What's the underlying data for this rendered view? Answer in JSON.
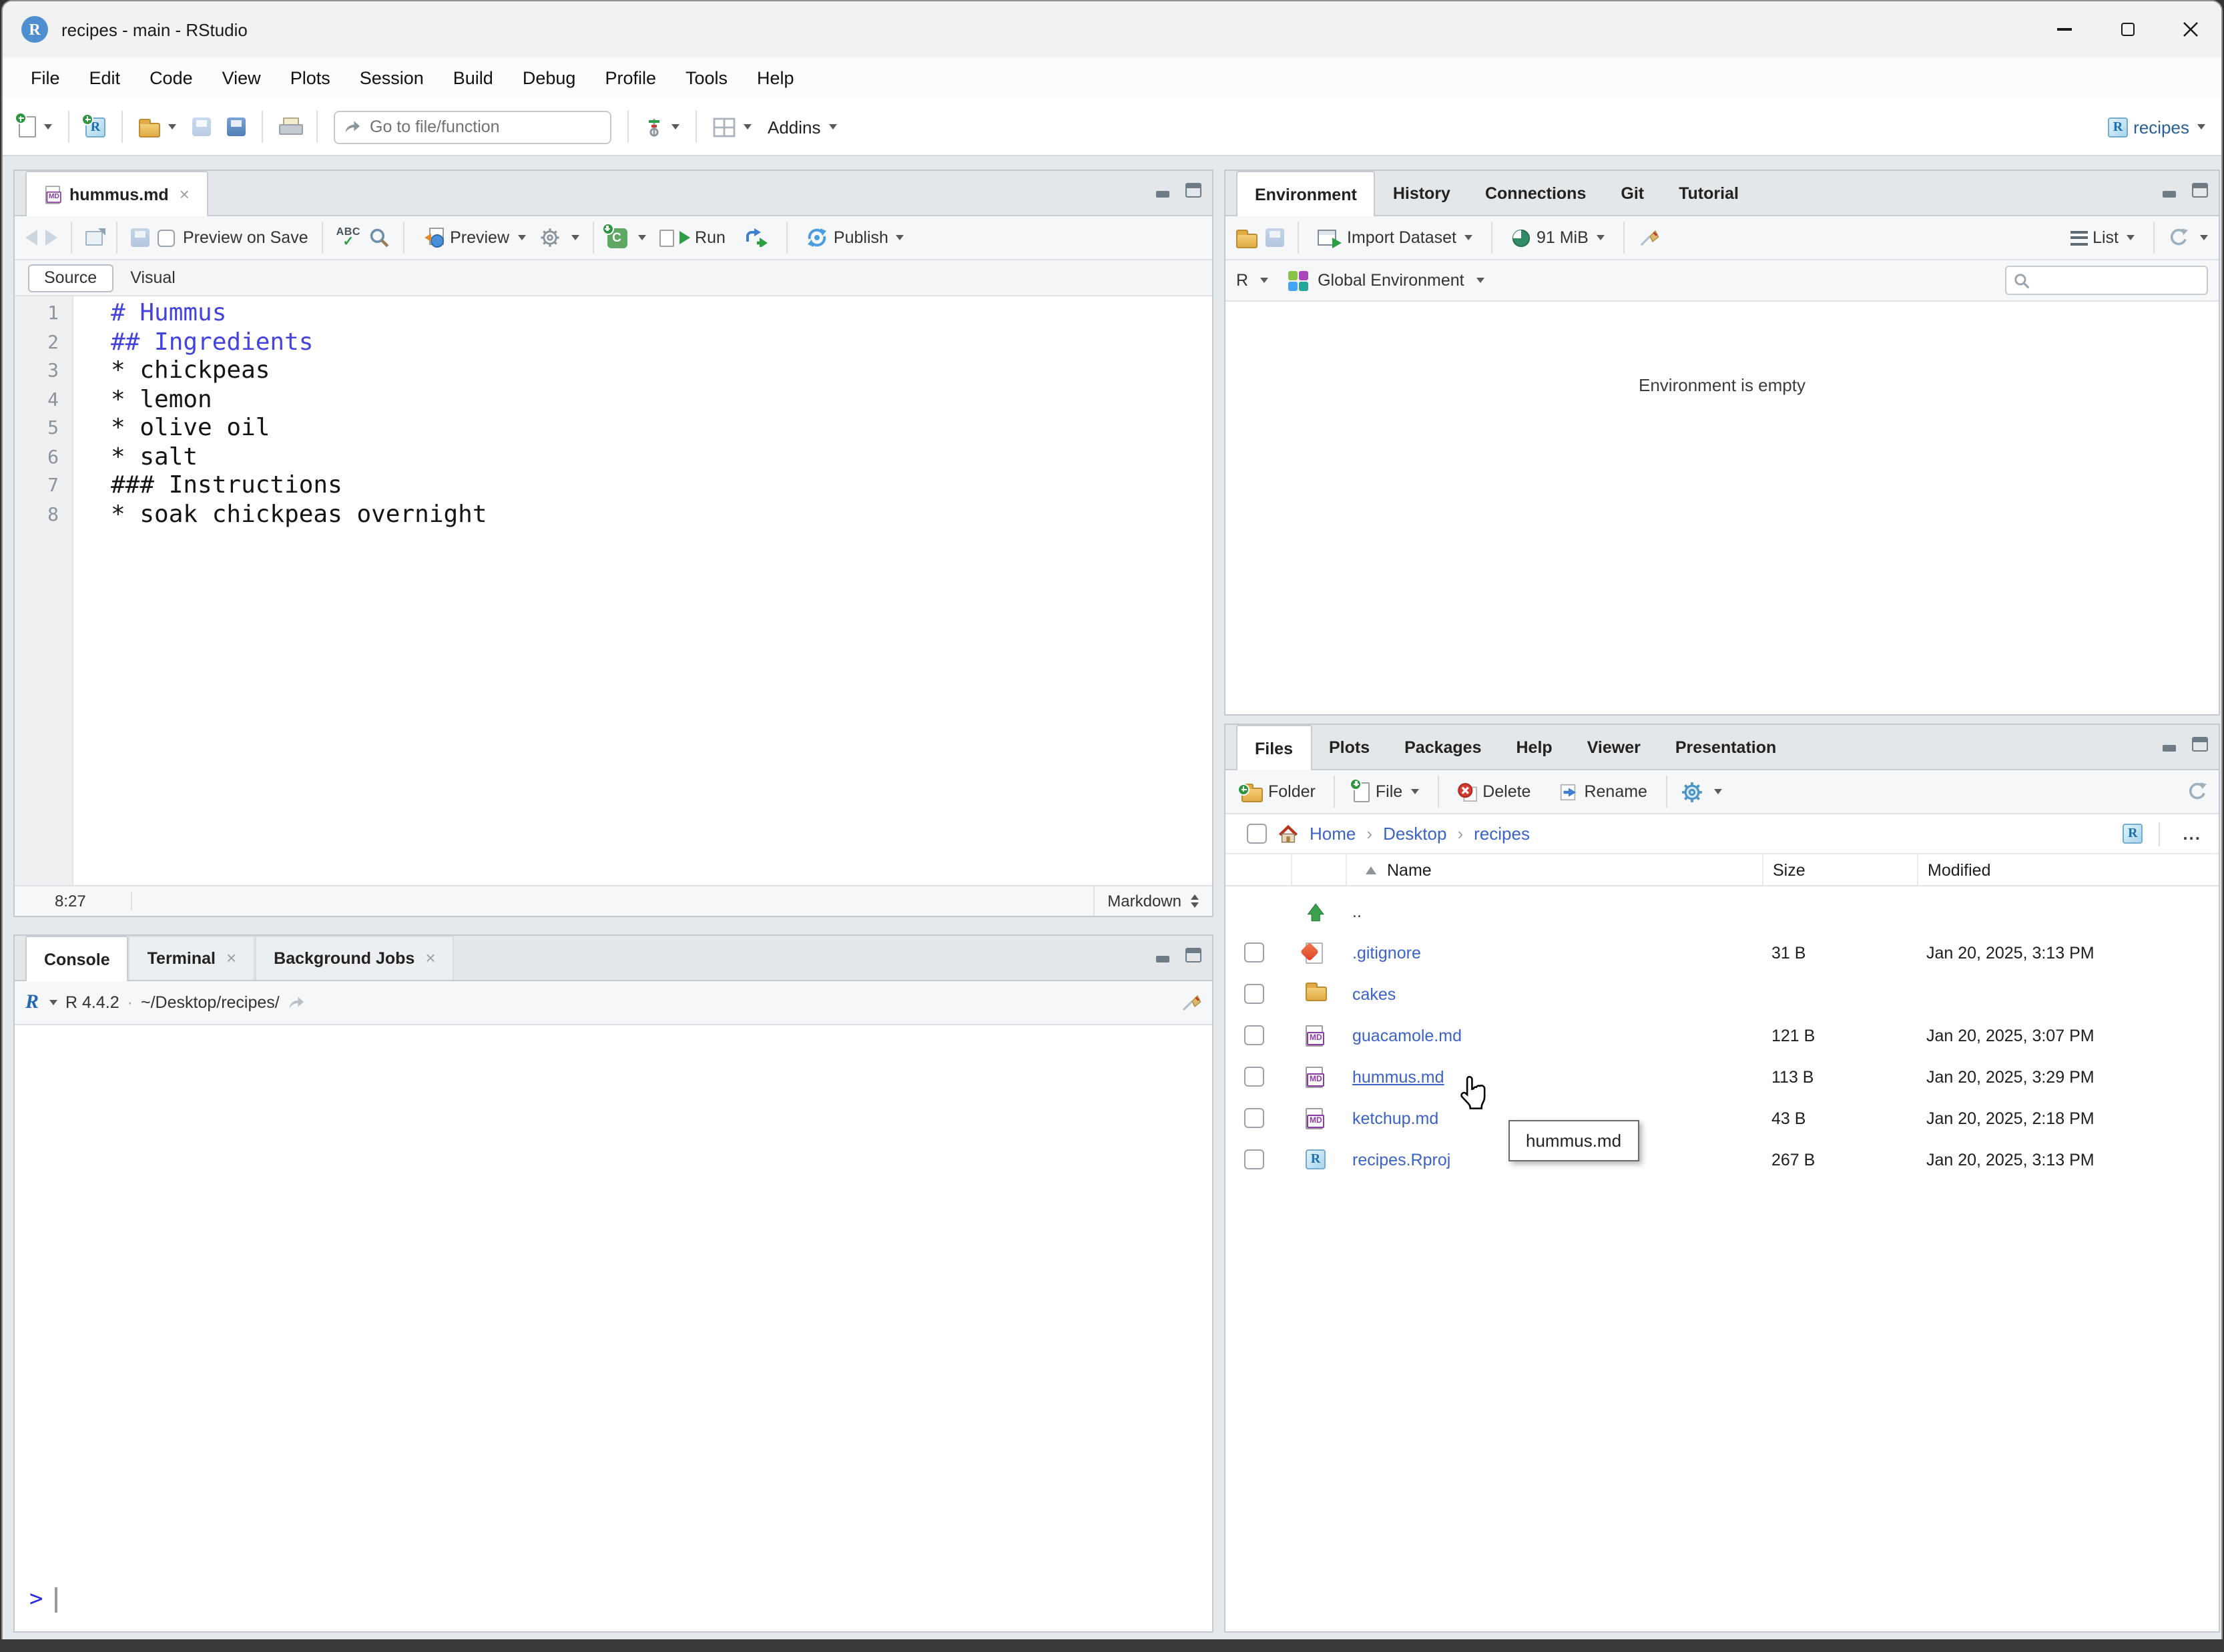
{
  "window": {
    "title": "recipes - main - RStudio"
  },
  "menu": {
    "items": [
      "File",
      "Edit",
      "Code",
      "View",
      "Plots",
      "Session",
      "Build",
      "Debug",
      "Profile",
      "Tools",
      "Help"
    ]
  },
  "toolbar": {
    "goto_placeholder": "Go to file/function",
    "addins_label": "Addins",
    "project_label": "recipes"
  },
  "editor": {
    "tab_title": "hummus.md",
    "preview_on_save": "Preview on Save",
    "preview_label": "Preview",
    "run_label": "Run",
    "publish_label": "Publish",
    "source_label": "Source",
    "visual_label": "Visual",
    "cursor_position": "8:27",
    "mode": "Markdown",
    "lines": [
      {
        "n": "1",
        "text": "# Hummus"
      },
      {
        "n": "2",
        "text": "## Ingredients"
      },
      {
        "n": "3",
        "text": "* chickpeas"
      },
      {
        "n": "4",
        "text": "* lemon"
      },
      {
        "n": "5",
        "text": "* olive oil"
      },
      {
        "n": "6",
        "text": "* salt"
      },
      {
        "n": "7",
        "text": "### Instructions"
      },
      {
        "n": "8",
        "text": "* soak chickpeas overnight"
      }
    ]
  },
  "console": {
    "tabs": [
      "Console",
      "Terminal",
      "Background Jobs"
    ],
    "r_version": "R 4.4.2",
    "sep": "·",
    "cwd": "~/Desktop/recipes/",
    "prompt": ">"
  },
  "environment": {
    "tabs": [
      "Environment",
      "History",
      "Connections",
      "Git",
      "Tutorial"
    ],
    "import_label": "Import Dataset",
    "memory": "91 MiB",
    "list_label": "List",
    "lang": "R",
    "scope": "Global Environment",
    "empty_text": "Environment is empty"
  },
  "files": {
    "tabs": [
      "Files",
      "Plots",
      "Packages",
      "Help",
      "Viewer",
      "Presentation"
    ],
    "toolbar": {
      "folder": "Folder",
      "file": "File",
      "delete": "Delete",
      "rename": "Rename"
    },
    "breadcrumb": {
      "home": "Home",
      "sep": "›",
      "desktop": "Desktop",
      "project": "recipes"
    },
    "more": "...",
    "headers": {
      "name": "Name",
      "size": "Size",
      "modified": "Modified"
    },
    "rows": [
      {
        "name": "..",
        "size": "",
        "modified": ""
      },
      {
        "name": ".gitignore",
        "size": "31 B",
        "modified": "Jan 20, 2025, 3:13 PM"
      },
      {
        "name": "cakes",
        "size": "",
        "modified": ""
      },
      {
        "name": "guacamole.md",
        "size": "121 B",
        "modified": "Jan 20, 2025, 3:07 PM"
      },
      {
        "name": "hummus.md",
        "size": "113 B",
        "modified": "Jan 20, 2025, 3:29 PM"
      },
      {
        "name": "ketchup.md",
        "size": "43 B",
        "modified": "Jan 20, 2025, 2:18 PM"
      },
      {
        "name": "recipes.Rproj",
        "size": "267 B",
        "modified": "Jan 20, 2025, 3:13 PM"
      }
    ],
    "tooltip": "hummus.md"
  },
  "colors": {
    "link": "#3b63c5",
    "heading": "#4444dd",
    "prompt": "#2a2ae6",
    "accent_blue": "#4f8fd0"
  }
}
